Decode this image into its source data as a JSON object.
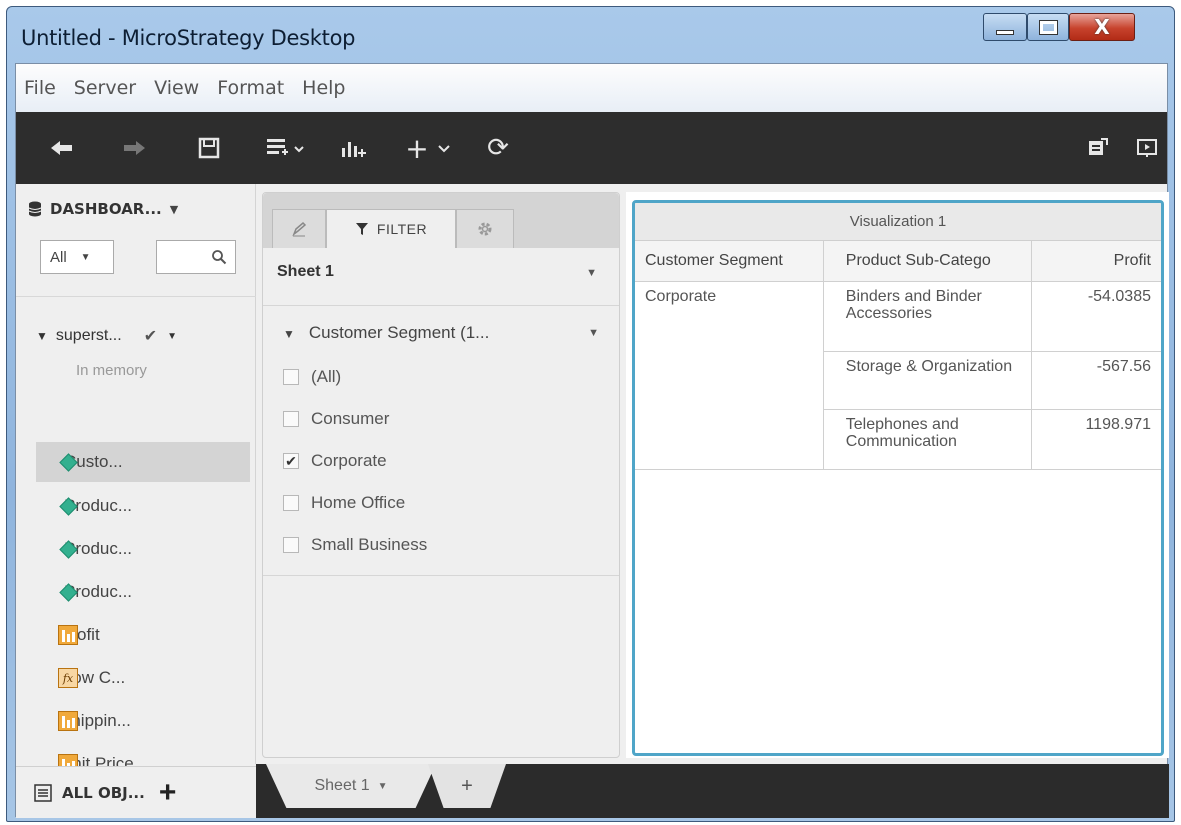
{
  "window": {
    "title": "Untitled - MicroStrategy Desktop",
    "minimize": "—",
    "maximize": "☐",
    "close": "X"
  },
  "menu": [
    "File",
    "Server",
    "View",
    "Format",
    "Help"
  ],
  "toolbar": {
    "icons": [
      "undo-icon",
      "redo-icon",
      "save-icon",
      "add-data-icon",
      "add-chart-icon",
      "insert-icon",
      "refresh-icon",
      "export-icon",
      "present-icon"
    ],
    "undo": "🡄",
    "redo": "🡆",
    "insert": "+",
    "refresh": "⟳"
  },
  "datasets": {
    "header": "DASHBOAR...",
    "filter_value": "All",
    "dataset_name": "superst...",
    "dataset_status": "In memory",
    "objects": [
      {
        "label": "Custo...",
        "type": "attribute",
        "selected": true
      },
      {
        "label": "Produc...",
        "type": "attribute",
        "selected": false
      },
      {
        "label": "Produc...",
        "type": "attribute",
        "selected": false
      },
      {
        "label": "Produc...",
        "type": "attribute",
        "selected": false
      },
      {
        "label": "Profit",
        "type": "metric",
        "selected": false
      },
      {
        "label": "Row C...",
        "type": "derived-metric",
        "selected": false
      },
      {
        "label": "Shippin...",
        "type": "metric",
        "selected": false
      },
      {
        "label": "Unit Price",
        "type": "metric",
        "selected": false
      }
    ],
    "bottom_label": "ALL OBJ...",
    "bottom_plus": "+"
  },
  "filter_panel": {
    "tab_filter": "FILTER",
    "sheet": "Sheet 1",
    "attribute": "Customer Segment (1...",
    "options": [
      {
        "label": "(All)",
        "checked": false
      },
      {
        "label": "Consumer",
        "checked": false
      },
      {
        "label": "Corporate",
        "checked": true
      },
      {
        "label": "Home Office",
        "checked": false
      },
      {
        "label": "Small Business",
        "checked": false
      }
    ]
  },
  "visualization": {
    "title": "Visualization 1",
    "columns": [
      "Customer Segment",
      "Product Sub-Catego",
      "Profit"
    ],
    "segment": "Corporate",
    "rows": [
      {
        "subcategory": "Binders and Binder Accessories",
        "profit": "-54.0385"
      },
      {
        "subcategory": "Storage & Organization",
        "profit": "-567.56"
      },
      {
        "subcategory": "Telephones and Communication",
        "profit": "1198.971"
      }
    ]
  },
  "sheets": {
    "tab_label": "Sheet 1",
    "add_label": "+"
  }
}
